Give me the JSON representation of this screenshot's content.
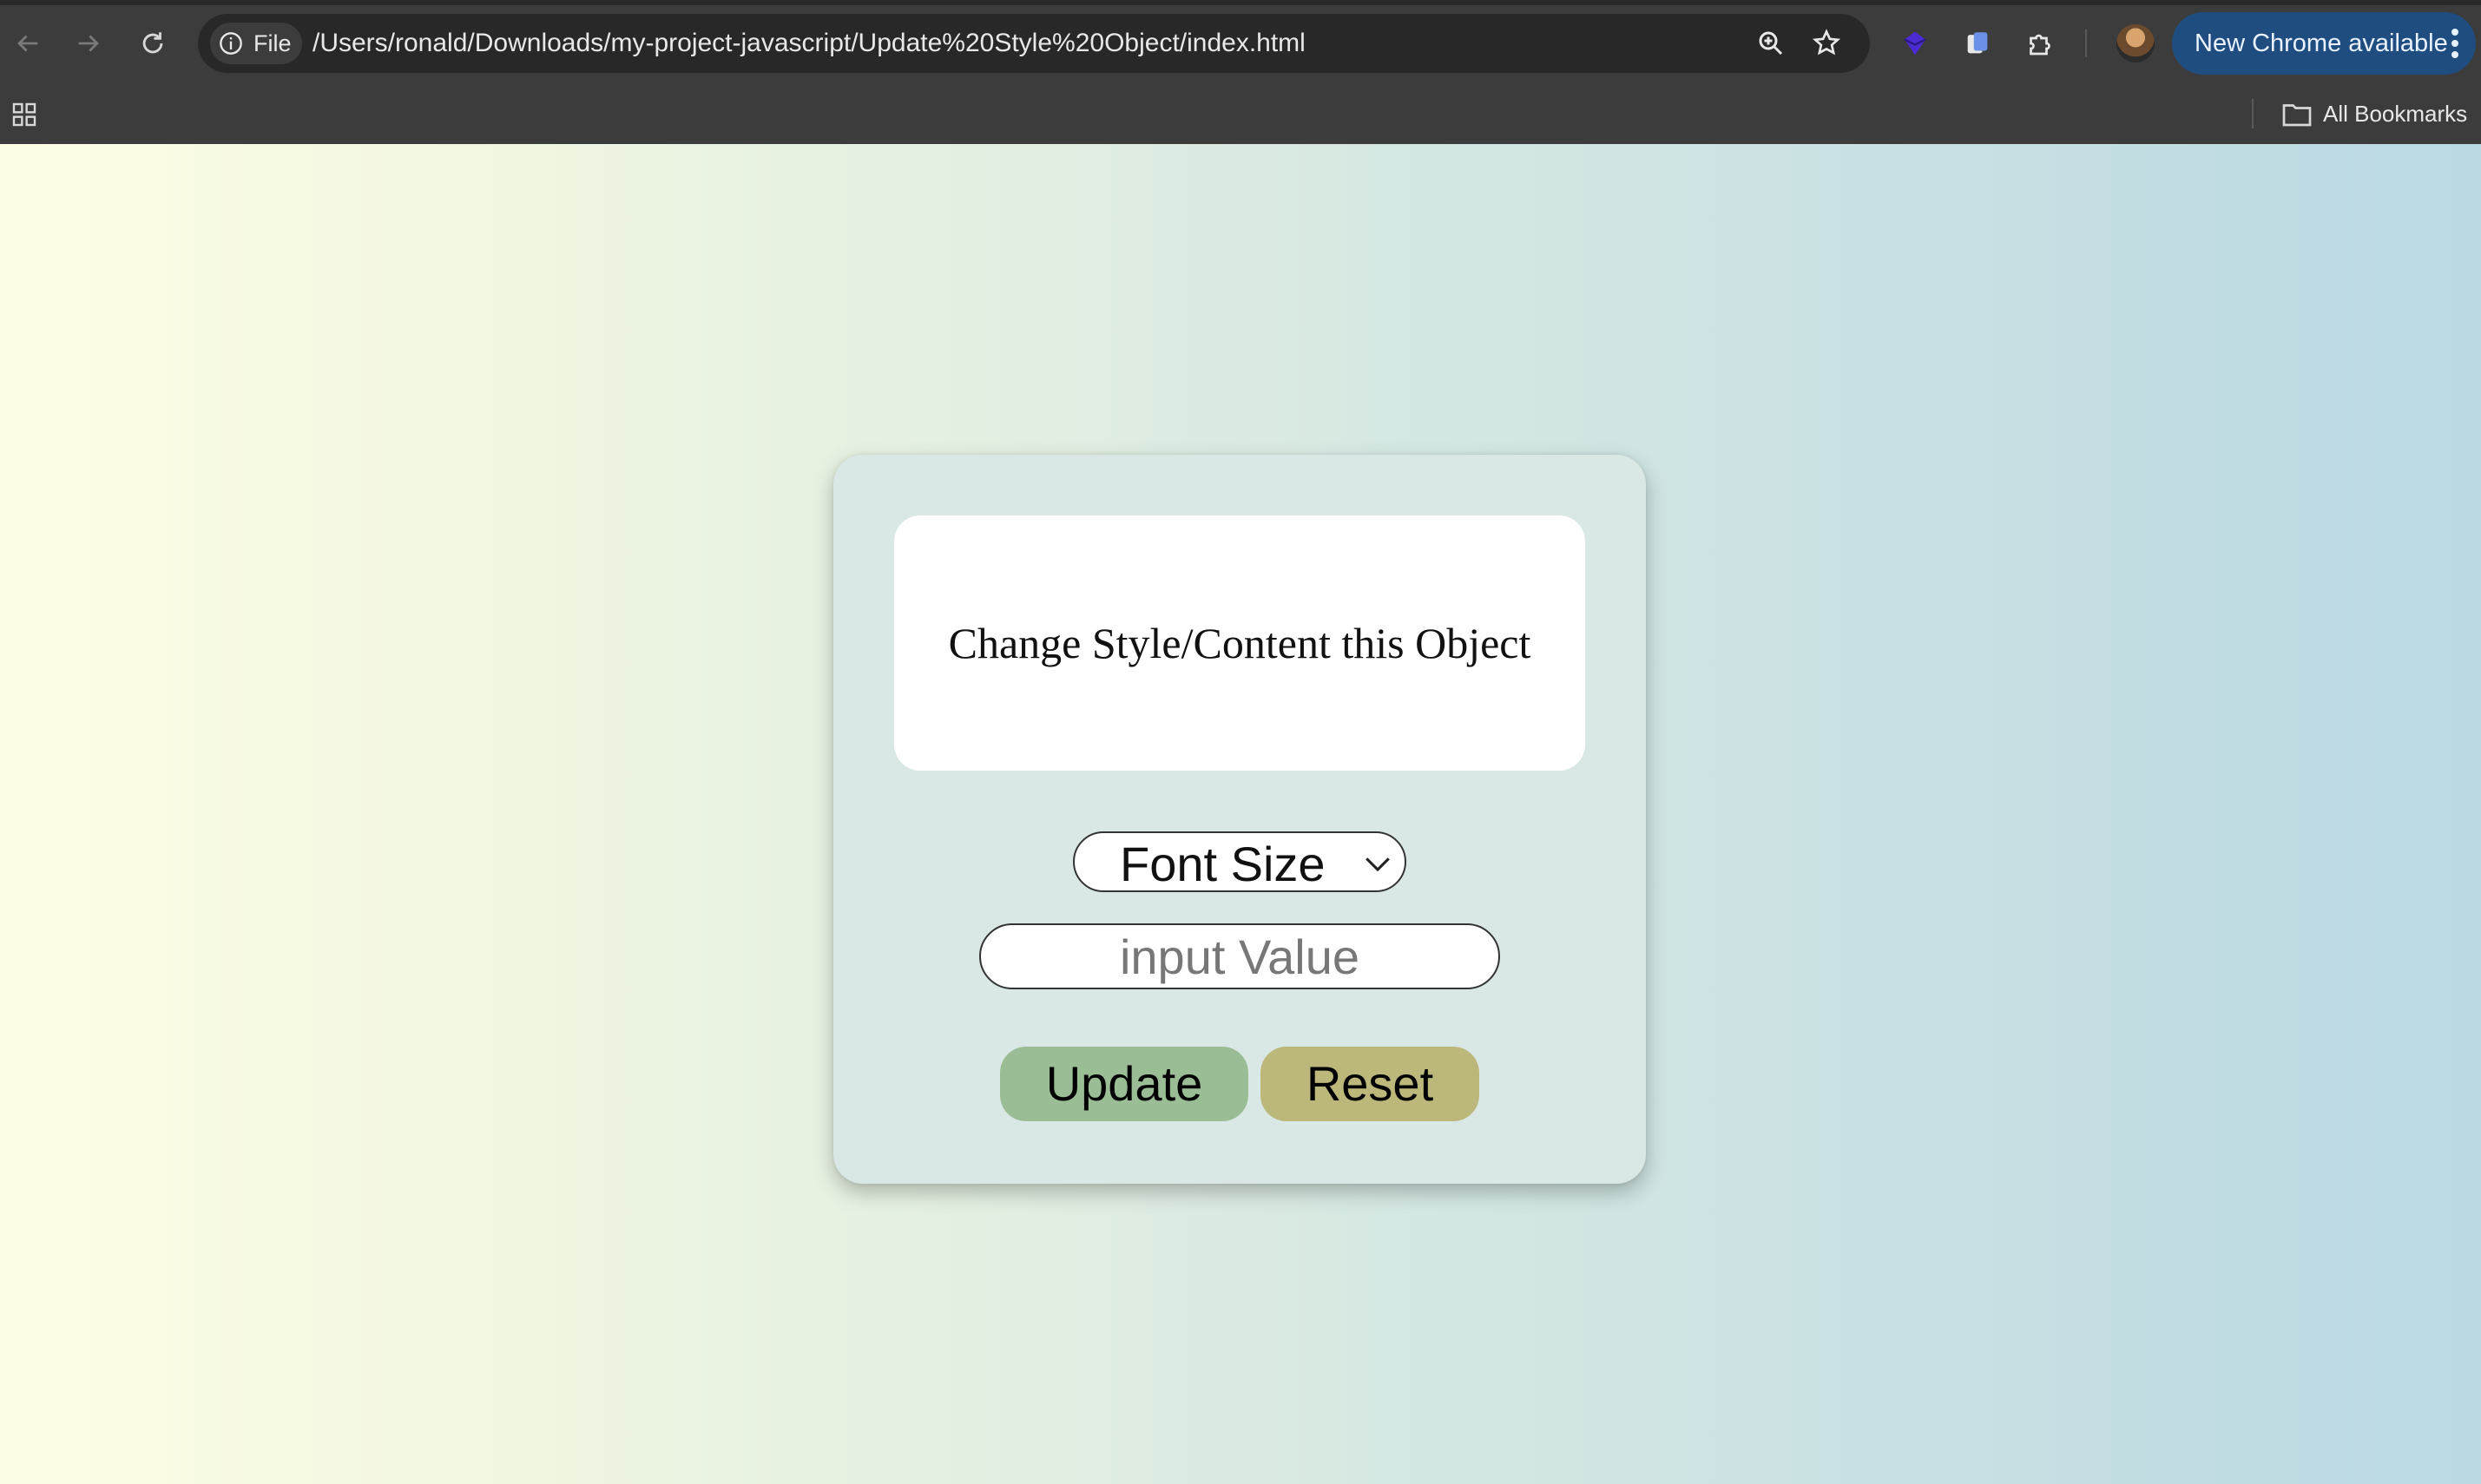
{
  "browser": {
    "site_chip_label": "File",
    "url": "/Users/ronald/Downloads/my-project-javascript/Update%20Style%20Object/index.html",
    "update_button_label": "New Chrome available",
    "bookmarks_label": "All Bookmarks",
    "icons": {
      "back": "arrow-left-icon",
      "forward": "arrow-right-icon",
      "reload": "reload-icon",
      "info": "info-icon",
      "zoom": "zoom-in-icon",
      "bookmark_star": "star-icon",
      "extension_1": "extension-icon",
      "extension_2": "extension-icon",
      "extensions_menu": "puzzle-icon",
      "apps": "apps-grid-icon",
      "folder": "folder-icon",
      "menu": "kebab-menu-icon"
    },
    "colors": {
      "chrome_bg": "#3c3c3c",
      "omnibox_bg": "#282828",
      "update_pill": "#1f4d80"
    }
  },
  "page": {
    "preview_text": "Change Style/Content this Object",
    "property_select": {
      "selected": "Font Size"
    },
    "value_input": {
      "value": "",
      "placeholder": "input Value"
    },
    "buttons": {
      "update_label": "Update",
      "reset_label": "Reset"
    },
    "colors": {
      "update_button": "#9bbd96",
      "reset_button": "#bcb77b",
      "card_bg": "#d9e8e4",
      "gradient_start": "#fefee4",
      "gradient_end": "#bad9e3"
    }
  }
}
